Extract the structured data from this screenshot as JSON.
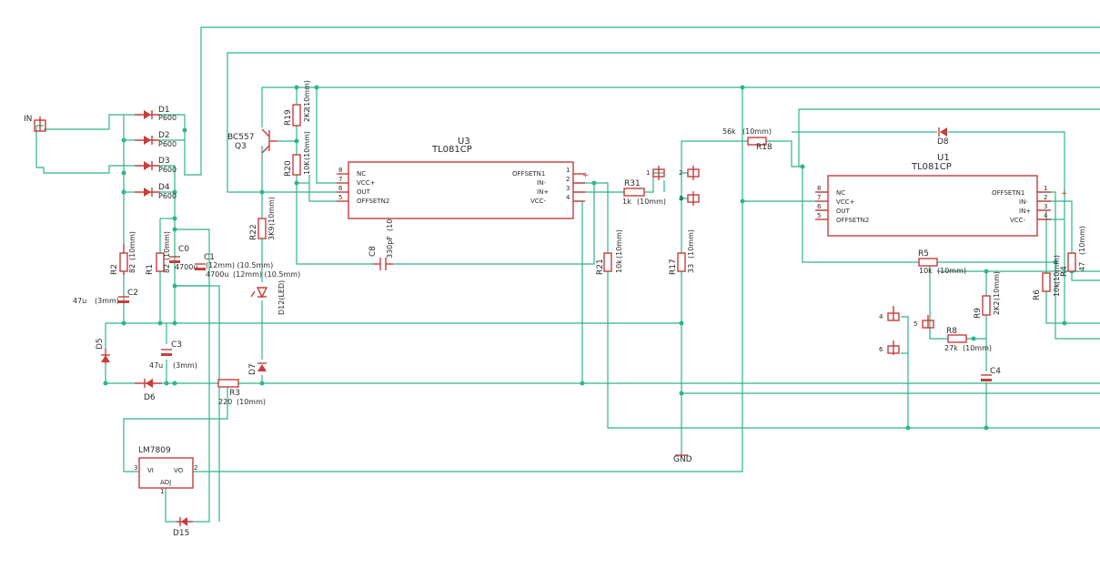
{
  "colors": {
    "wire": "#2fb58b",
    "part": "#c83c3c",
    "background": "#ffffff",
    "text": "#2a2a2a"
  },
  "input": {
    "name": "IN"
  },
  "bridge": {
    "diodes": [
      {
        "name": "D1",
        "value": "P600"
      },
      {
        "name": "D2",
        "value": "P600"
      },
      {
        "name": "D3",
        "value": "P600"
      },
      {
        "name": "D4",
        "value": "P600"
      }
    ]
  },
  "supply": {
    "R2": {
      "name": "R2",
      "value": "82",
      "pkg": "(10mm)"
    },
    "R1": {
      "name": "R1",
      "value": "82",
      "pkg": "(10mm)"
    },
    "C2": {
      "name": "C2",
      "value": "47u",
      "pkg": "(3mm)"
    },
    "C0": {
      "name": "C0",
      "value": "4700u",
      "pkg": "(12mm) (10.5mm)"
    },
    "C1": {
      "name": "C1",
      "value": "4700u",
      "pkg": "(12mm) (10.5mm)"
    },
    "C3": {
      "name": "C3",
      "value": "47u",
      "pkg": "(3mm)"
    },
    "D5": {
      "name": "D5"
    },
    "D6": {
      "name": "D6"
    },
    "R3": {
      "name": "R3",
      "value": "220",
      "pkg": "(10mm)"
    },
    "reg": {
      "name": "LM7809",
      "vi": "VI",
      "vo": "VO",
      "adj": "ADJ",
      "pin_vi": "3",
      "pin_vo": "2",
      "pin_adj": "1"
    },
    "D15": {
      "name": "D15"
    }
  },
  "stage1": {
    "Q3": {
      "name": "Q3",
      "value": "BC557"
    },
    "R19": {
      "name": "R19",
      "value": "2K2",
      "pkg": "(10mm)"
    },
    "R20": {
      "name": "R20",
      "value": "10K",
      "pkg": "(10mm)"
    },
    "R22": {
      "name": "R22",
      "value": "3K9",
      "pkg": "(10mm)"
    },
    "D12": {
      "name": "D12(LED)"
    },
    "D7": {
      "name": "D7"
    },
    "C8": {
      "name": "C8",
      "value": "330pF",
      "pkg": "(10mm)"
    },
    "U3": {
      "name": "U3",
      "part": "TL081CP",
      "left_pins": [
        {
          "num": "8",
          "label": "NC"
        },
        {
          "num": "7",
          "label": "VCC+"
        },
        {
          "num": "6",
          "label": "OUT"
        },
        {
          "num": "5",
          "label": "OFFSETN2"
        }
      ],
      "right_pins": [
        {
          "num": "1",
          "label": "OFFSETN1"
        },
        {
          "num": "2",
          "label": "IN-"
        },
        {
          "num": "3",
          "label": "IN+"
        },
        {
          "num": "4",
          "label": "VCC-"
        }
      ]
    },
    "R31": {
      "name": "R31",
      "value": "1k",
      "pkg": "(10mm)"
    },
    "R21": {
      "name": "R21",
      "value": "10k",
      "pkg": "(10mm)"
    },
    "R17": {
      "name": "R17",
      "value": "33",
      "pkg": "(10mm)"
    },
    "J1": {
      "name": "1"
    },
    "J2": {
      "name": "2"
    },
    "J3": {
      "name": "3"
    },
    "gnd": "GND"
  },
  "stage2": {
    "R18": {
      "name": "R18",
      "value": "56k",
      "pkg": "(10mm)"
    },
    "D8": {
      "name": "D8"
    },
    "U1": {
      "name": "U1",
      "part": "TL081CP",
      "left_pins": [
        {
          "num": "8",
          "label": "NC"
        },
        {
          "num": "7",
          "label": "VCC+"
        },
        {
          "num": "6",
          "label": "OUT"
        },
        {
          "num": "5",
          "label": "OFFSETN2"
        }
      ],
      "right_pins": [
        {
          "num": "1",
          "label": "OFFSETN1"
        },
        {
          "num": "2",
          "label": "IN-"
        },
        {
          "num": "3",
          "label": "IN+"
        },
        {
          "num": "4",
          "label": "VCC-"
        }
      ]
    },
    "R5": {
      "name": "R5",
      "value": "10k",
      "pkg": "(10mm)"
    },
    "R4": {
      "name": "R4",
      "value": "47",
      "pkg": "(10mm)"
    },
    "R6": {
      "name": "R6",
      "value": "10k",
      "pkg": "(10mm)"
    },
    "R9": {
      "name": "R9",
      "value": "2K2",
      "pkg": "(10mm)"
    },
    "R8": {
      "name": "R8",
      "value": "27k",
      "pkg": "(10mm)"
    },
    "C4": {
      "name": "C4"
    },
    "J4": {
      "name": "4"
    },
    "J5": {
      "name": "5"
    },
    "J6": {
      "name": "6"
    }
  }
}
